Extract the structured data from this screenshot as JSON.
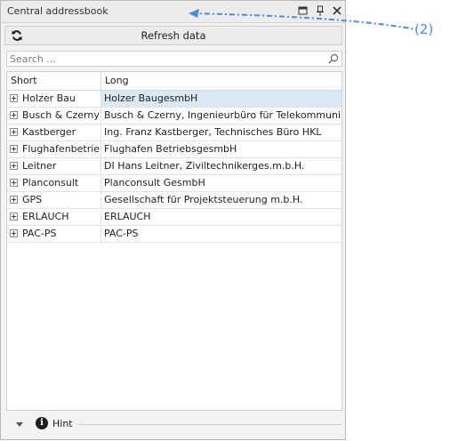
{
  "window": {
    "title": "Central addressbook",
    "buttons": [
      "maximize-icon",
      "pin-icon",
      "close-icon"
    ]
  },
  "toolbar": {
    "refresh_label": "Refresh data",
    "refresh_icon": "refresh-icon"
  },
  "search": {
    "placeholder": "Search ...",
    "value": "",
    "icon": "search-icon"
  },
  "grid": {
    "columns": [
      "Short",
      "Long"
    ],
    "rows": [
      {
        "short": "Holzer Bau",
        "long": "Holzer BaugesmbH"
      },
      {
        "short": "Busch & Czerny",
        "long": "Busch & Czerny, Ingenieurbüro für Telekommunikation"
      },
      {
        "short": "Kastberger",
        "long": "Ing. Franz Kastberger, Technisches Büro HKL"
      },
      {
        "short": "Flughafenbetrieb",
        "long": "Flughafen BetriebsgesmbH"
      },
      {
        "short": "Leitner",
        "long": "DI Hans Leitner, Ziviltechnikerges.m.b.H."
      },
      {
        "short": "Planconsult",
        "long": "Planconsult GesmbH"
      },
      {
        "short": "GPS",
        "long": "Gesellschaft für Projektsteuerung m.b.H."
      },
      {
        "short": "ERLAUCH",
        "long": "ERLAUCH"
      },
      {
        "short": "PAC-PS",
        "long": "PAC-PS"
      }
    ]
  },
  "hint": {
    "label": "Hint",
    "icon": "info-icon"
  },
  "annotation": {
    "label": "(2)",
    "color": "#4a90d9"
  }
}
